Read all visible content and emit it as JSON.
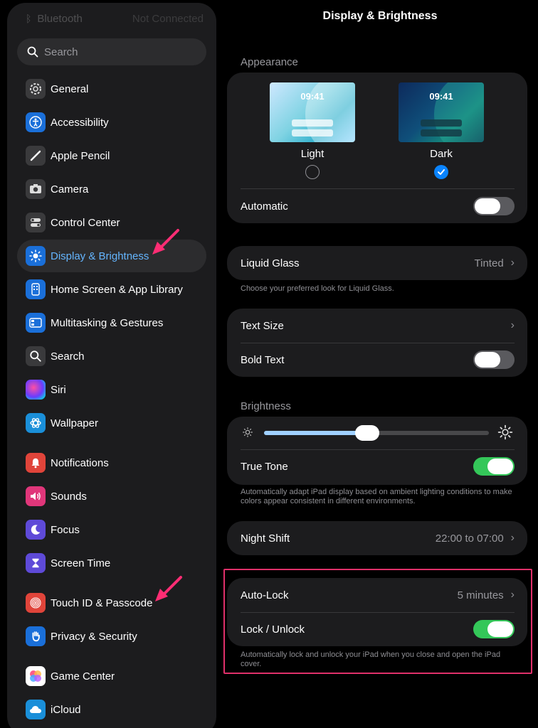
{
  "sidebar": {
    "top_item": {
      "label": "Bluetooth",
      "value": "Not Connected"
    },
    "search_placeholder": "Search",
    "items": [
      {
        "label": "General",
        "icon": "gear-icon"
      },
      {
        "label": "Accessibility",
        "icon": "accessibility-icon"
      },
      {
        "label": "Apple Pencil",
        "icon": "pencil-icon"
      },
      {
        "label": "Camera",
        "icon": "camera-icon"
      },
      {
        "label": "Control Center",
        "icon": "toggles-icon"
      },
      {
        "label": "Display & Brightness",
        "icon": "sun-icon"
      },
      {
        "label": "Home Screen & App Library",
        "icon": "home-screen-icon"
      },
      {
        "label": "Multitasking & Gestures",
        "icon": "multitasking-icon"
      },
      {
        "label": "Search",
        "icon": "magnifier-icon"
      },
      {
        "label": "Siri",
        "icon": "siri-icon"
      },
      {
        "label": "Wallpaper",
        "icon": "wallpaper-icon"
      },
      {
        "label": "Notifications",
        "icon": "bell-icon"
      },
      {
        "label": "Sounds",
        "icon": "speaker-icon"
      },
      {
        "label": "Focus",
        "icon": "moon-icon"
      },
      {
        "label": "Screen Time",
        "icon": "hourglass-icon"
      },
      {
        "label": "Touch ID & Passcode",
        "icon": "fingerprint-icon"
      },
      {
        "label": "Privacy & Security",
        "icon": "hand-icon"
      },
      {
        "label": "Game Center",
        "icon": "game-center-icon"
      },
      {
        "label": "iCloud",
        "icon": "cloud-icon"
      }
    ]
  },
  "main": {
    "title": "Display & Brightness",
    "appearance": {
      "header": "Appearance",
      "light_label": "Light",
      "dark_label": "Dark",
      "preview_time": "09:41",
      "selected": "Dark",
      "automatic_label": "Automatic",
      "automatic_on": false
    },
    "liquid_glass": {
      "label": "Liquid Glass",
      "value": "Tinted",
      "footnote": "Choose your preferred look for Liquid Glass."
    },
    "text": {
      "text_size_label": "Text Size",
      "bold_text_label": "Bold Text",
      "bold_text_on": false
    },
    "brightness": {
      "header": "Brightness",
      "level": 0.46,
      "true_tone_label": "True Tone",
      "true_tone_on": true,
      "footnote": "Automatically adapt iPad display based on ambient lighting conditions to make colors appear consistent in different environments."
    },
    "night_shift": {
      "label": "Night Shift",
      "value": "22:00 to 07:00"
    },
    "lock": {
      "auto_lock_label": "Auto-Lock",
      "auto_lock_value": "5 minutes",
      "lock_unlock_label": "Lock / Unlock",
      "lock_unlock_on": true,
      "footnote": "Automatically lock and unlock your iPad when you close and open the iPad cover."
    }
  },
  "colors": {
    "accent": "#0a84ff",
    "selected_text": "#64b5ff",
    "toggle_on": "#34c759",
    "annotation": "#e0306a"
  }
}
